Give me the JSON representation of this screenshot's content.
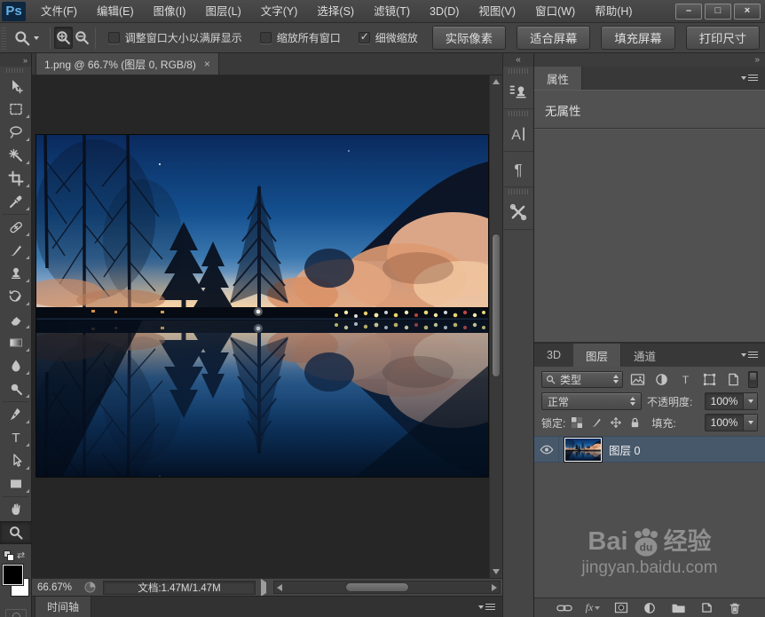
{
  "titlebar": {
    "logo": "Ps",
    "menus": [
      "文件(F)",
      "编辑(E)",
      "图像(I)",
      "图层(L)",
      "文字(Y)",
      "选择(S)",
      "滤镜(T)",
      "3D(D)",
      "视图(V)",
      "窗口(W)",
      "帮助(H)"
    ],
    "window_controls": {
      "minimize": "–",
      "maximize": "□",
      "close": "×"
    }
  },
  "options_bar": {
    "checkboxes": [
      {
        "label": "调整窗口大小以满屏显示",
        "checked": false
      },
      {
        "label": "缩放所有窗口",
        "checked": false
      },
      {
        "label": "细微缩放",
        "checked": true
      }
    ],
    "buttons": [
      "实际像素",
      "适合屏幕",
      "填充屏幕",
      "打印尺寸"
    ]
  },
  "document": {
    "tab_title": "1.png @ 66.7% (图层 0, RGB/8)",
    "close": "×"
  },
  "toolbar": {
    "tools": [
      "move",
      "rectangular-marquee",
      "lasso",
      "magic-wand",
      "crop",
      "eyedropper",
      "spot-healing-brush",
      "brush",
      "clone-stamp",
      "history-brush",
      "eraser",
      "gradient",
      "blur",
      "dodge",
      "pen",
      "type",
      "path-selection",
      "rectangle",
      "hand",
      "zoom"
    ],
    "active_tool": "zoom"
  },
  "right_strip": {
    "icons": [
      "clone-source",
      "character",
      "paragraph",
      "tool-presets"
    ]
  },
  "properties_panel": {
    "tab": "属性",
    "empty_text": "无属性"
  },
  "layers_panel": {
    "tabs": [
      "3D",
      "图层",
      "通道"
    ],
    "active_tab": "图层",
    "filter_type": "类型",
    "blend_mode": "正常",
    "opacity_label": "不透明度:",
    "opacity_value": "100%",
    "lock_label": "锁定:",
    "fill_label": "填充:",
    "fill_value": "100%",
    "layer": {
      "name": "图层 0",
      "visible": true,
      "selected": true
    }
  },
  "status_bar": {
    "zoom_level": "66.67%",
    "doc_info": "文档:1.47M/1.47M"
  },
  "timeline": {
    "tab": "时间轴"
  },
  "watermark": {
    "brand_prefix": "Bai",
    "brand_paw_text": "du",
    "brand_suffix": "经验",
    "url": "jingyan.baidu.com"
  },
  "colors": {
    "selection_blue": "#47586b",
    "logo_blue": "#64b1e4",
    "panel_bg": "#4f4f4f",
    "canvas_bg": "#262626"
  }
}
